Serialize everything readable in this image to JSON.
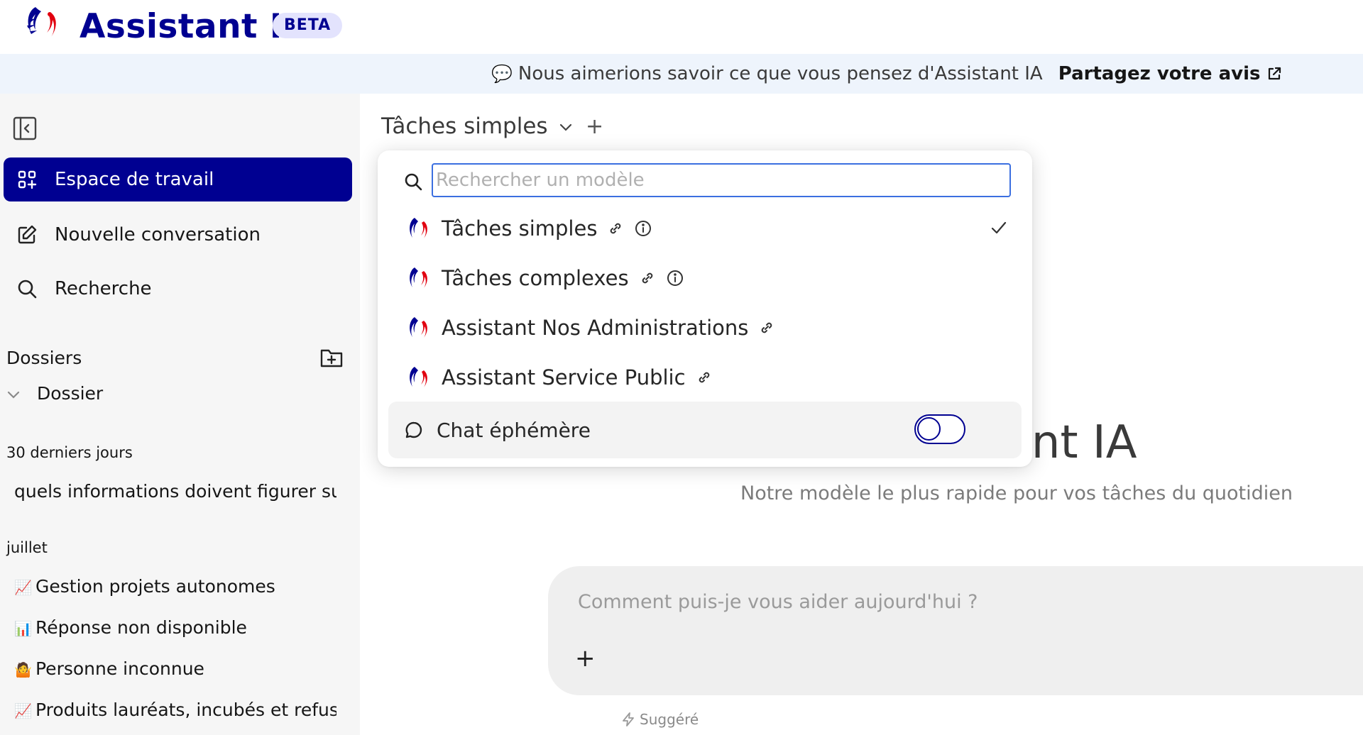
{
  "header": {
    "title": "Assistant IA",
    "badge": "BETA"
  },
  "notice": {
    "icon": "speech-bubble-icon",
    "message": "Nous aimerions savoir ce que vous pensez d'Assistant IA",
    "link_label": "Partagez votre avis"
  },
  "sidebar": {
    "nav": [
      {
        "label": "Espace de travail",
        "icon": "workspace-icon",
        "active": true
      },
      {
        "label": "Nouvelle conversation",
        "icon": "edit-icon",
        "active": false
      },
      {
        "label": "Recherche",
        "icon": "search-icon",
        "active": false
      }
    ],
    "folders_label": "Dossiers",
    "folder": "Dossier",
    "sections": [
      {
        "label": "30 derniers jours",
        "items": [
          {
            "emoji": "",
            "title": "quels informations doivent figurer sur"
          }
        ]
      },
      {
        "label": "juillet",
        "items": [
          {
            "emoji": "📈",
            "title": "Gestion projets autonomes"
          },
          {
            "emoji": "📊",
            "title": "Réponse non disponible"
          },
          {
            "emoji": "🤷",
            "title": "Personne inconnue"
          },
          {
            "emoji": "📈",
            "title": "Produits lauréats, incubés et refusés"
          }
        ]
      }
    ]
  },
  "main": {
    "model_selector": "Tâches simples",
    "new_tab": "+",
    "hero_title": "Assistant IA",
    "hero_subtitle": "Notre modèle le plus rapide pour vos tâches du quotidien",
    "composer_placeholder": "Comment puis-je vous aider aujourd'hui ?",
    "composer_add": "+",
    "suggest_label": "Suggéré"
  },
  "dropdown": {
    "search_placeholder": "Rechercher un modèle",
    "models": [
      {
        "name": "Tâches simples",
        "has_info": true,
        "selected": true
      },
      {
        "name": "Tâches complexes",
        "has_info": true,
        "selected": false
      },
      {
        "name": "Assistant Nos Administrations",
        "has_info": false,
        "selected": false
      },
      {
        "name": "Assistant Service Public",
        "has_info": false,
        "selected": false
      }
    ],
    "ephemeral_label": "Chat éphémère",
    "ephemeral_enabled": false
  },
  "colors": {
    "brand_blue": "#000091",
    "brand_red": "#e1000f",
    "sidebar_bg": "#f6f6f6",
    "notice_bg": "#eef4fc",
    "focus_border": "#3b6fe0"
  }
}
